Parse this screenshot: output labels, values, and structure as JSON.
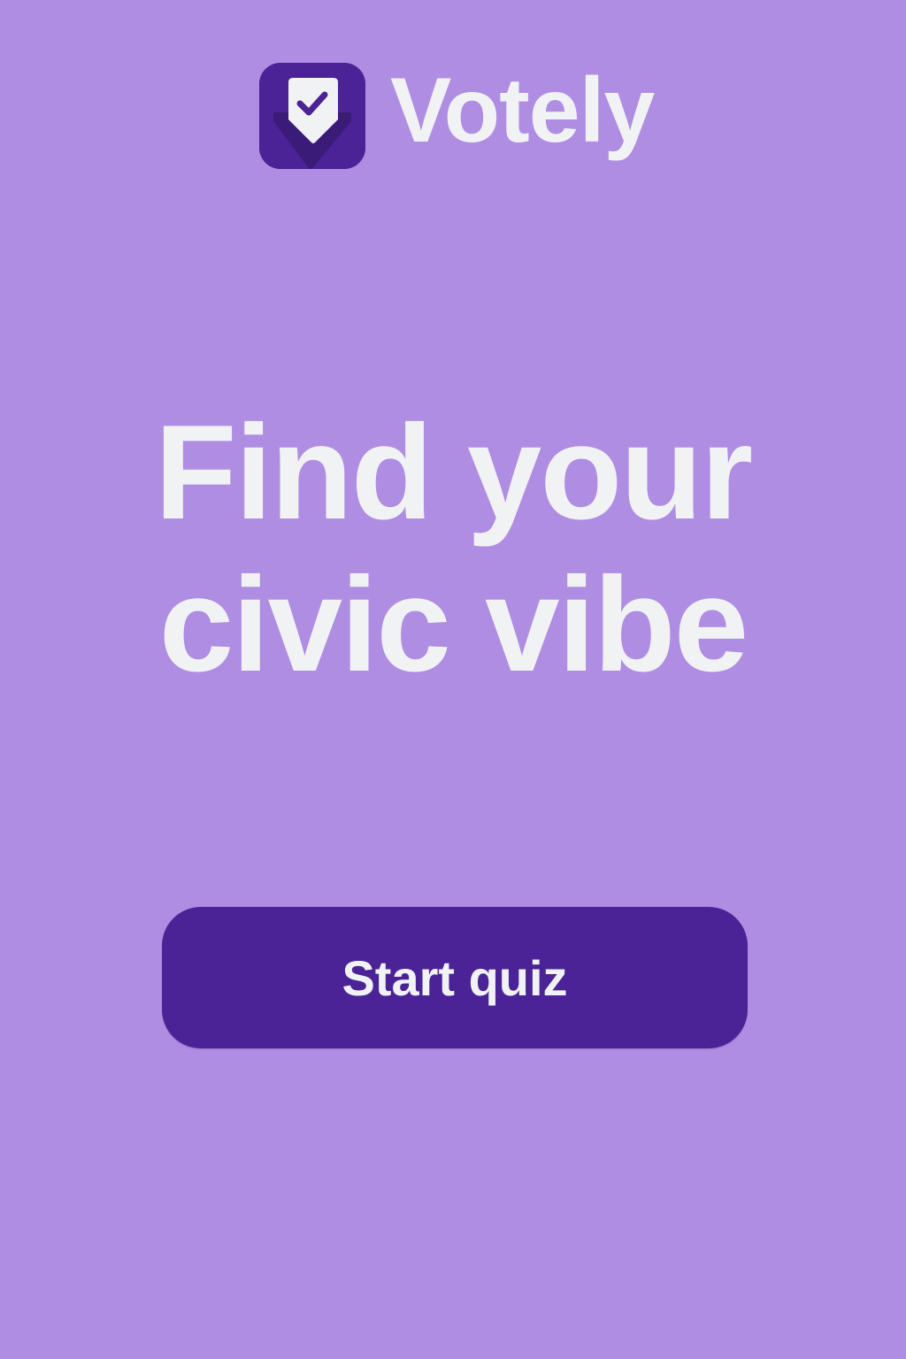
{
  "colors": {
    "background": "#AE8DE2",
    "brand_dark": "#4B2396",
    "icon_shadow": "#3A1C78",
    "text_light": "#F1F2F4"
  },
  "brand": {
    "icon": "ballot-shield-check-icon",
    "name": "Votely"
  },
  "hero": {
    "line1": "Find your",
    "line2": "civic vibe"
  },
  "cta": {
    "label": "Start quiz"
  }
}
